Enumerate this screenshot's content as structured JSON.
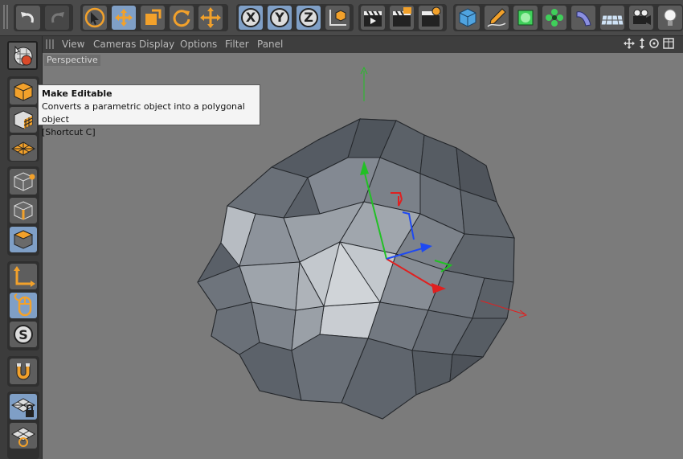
{
  "menu": {
    "items": [
      "View",
      "Cameras",
      "Display",
      "Options",
      "Filter",
      "Panel"
    ]
  },
  "viewport": {
    "label": "Perspective"
  },
  "tooltip": {
    "title": "Make Editable",
    "description": "Converts a parametric object into a polygonal object",
    "shortcut": "[Shortcut C]"
  },
  "toolbar": {
    "axis_x": "X",
    "axis_y": "Y",
    "axis_z": "Z"
  },
  "colors": {
    "accent_orange": "#f2a12b",
    "selected_blue": "#7f9fc6",
    "axis_x": "#e02020",
    "axis_y": "#22c025",
    "axis_z": "#1e49f2",
    "object_gray": "#5a6068"
  }
}
